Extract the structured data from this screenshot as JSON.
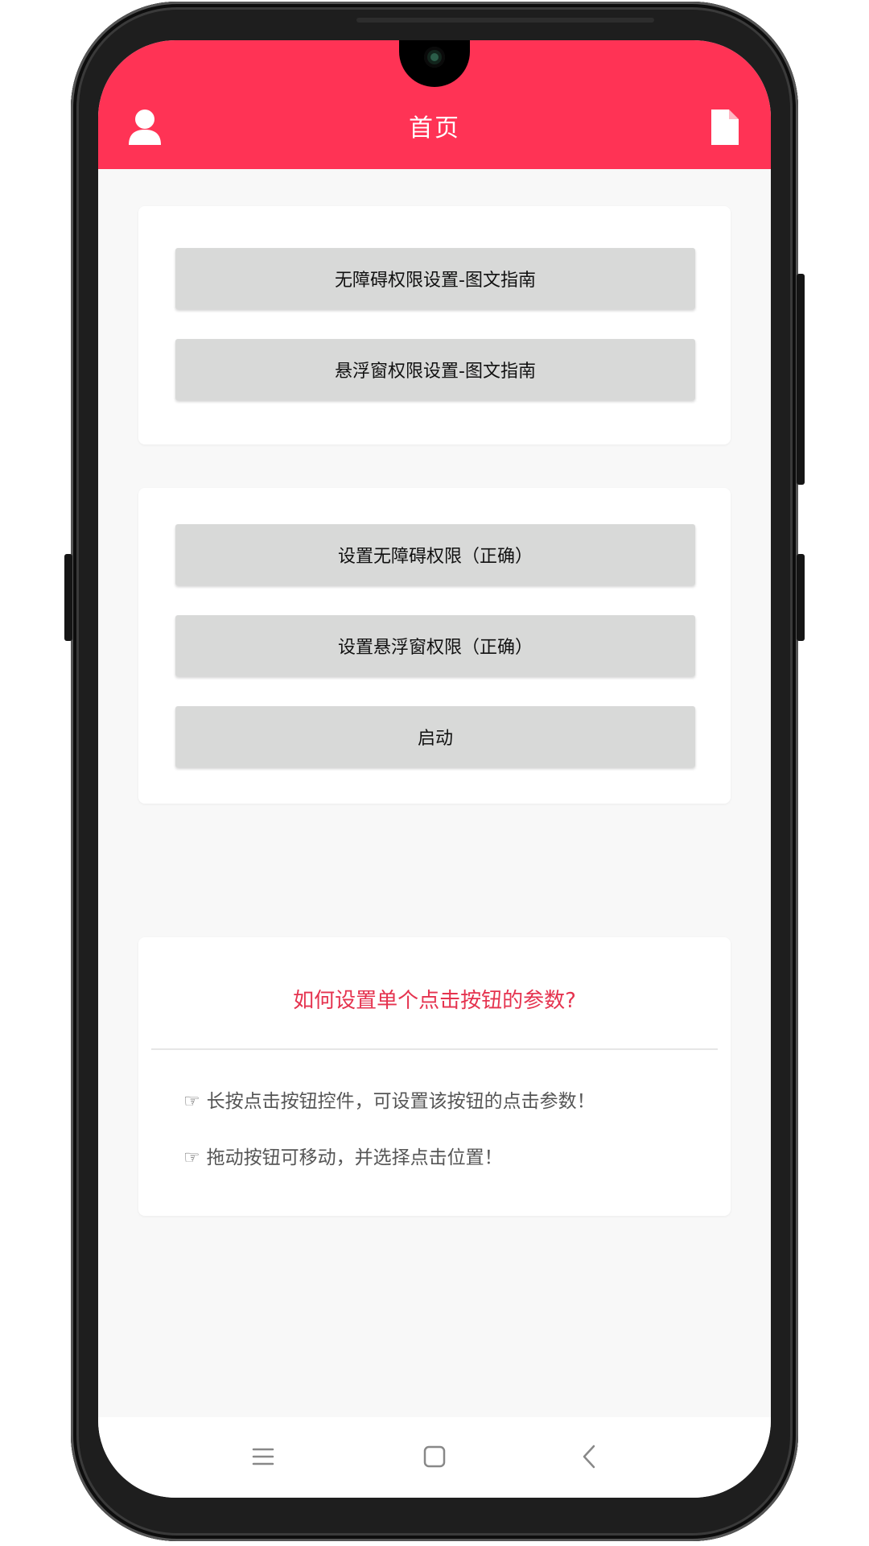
{
  "header": {
    "title": "首页",
    "left_icon": "user-icon",
    "right_icon": "document-icon",
    "color": "#ff3355"
  },
  "guides": {
    "accessibility_guide": "无障碍权限设置-图文指南",
    "floating_guide": "悬浮窗权限设置-图文指南"
  },
  "actions": {
    "set_accessibility": "设置无障碍权限（正确）",
    "set_floating": "设置悬浮窗权限（正确）",
    "start": "启动"
  },
  "help": {
    "title": "如何设置单个点击按钮的参数?",
    "title_color": "#e5334f",
    "tips": [
      {
        "icon": "☞",
        "text": "长按点击按钮控件，可设置该按钮的点击参数！"
      },
      {
        "icon": "☞",
        "text": "拖动按钮可移动，并选择点击位置！"
      }
    ]
  },
  "navbar": {
    "icons": [
      "menu-icon",
      "home-icon",
      "back-icon"
    ]
  }
}
